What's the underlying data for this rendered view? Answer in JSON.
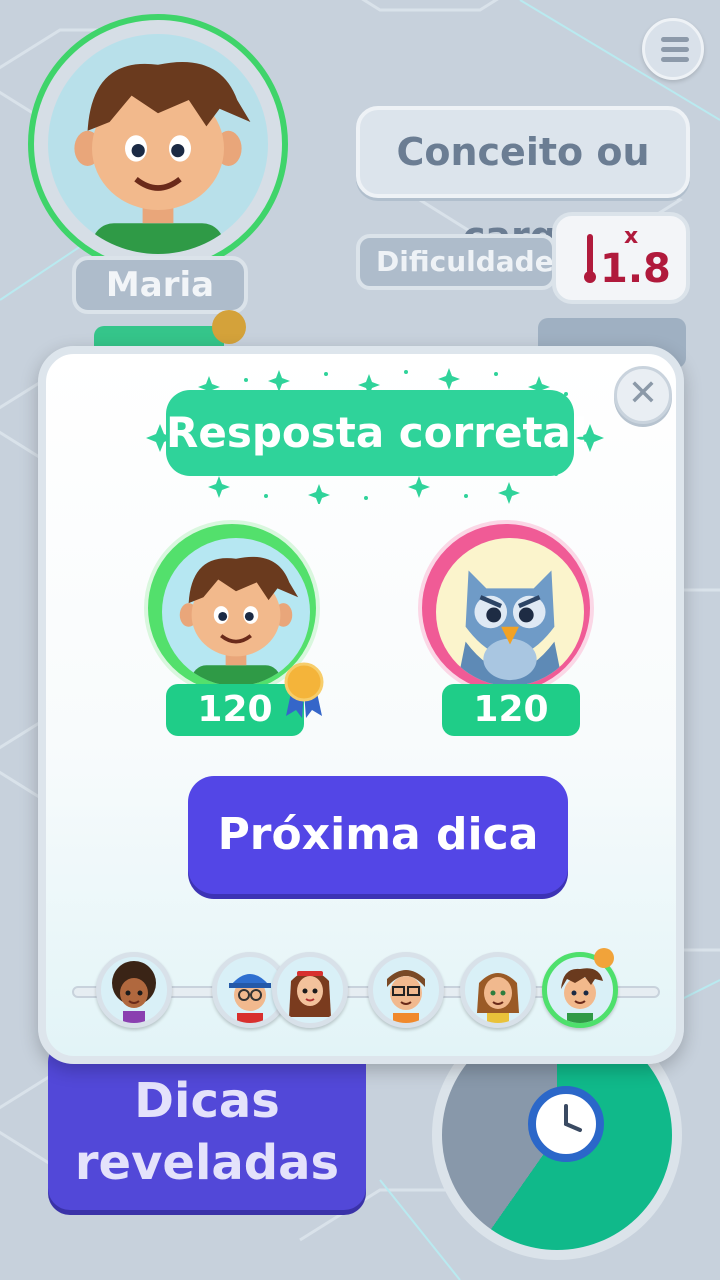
{
  "header": {
    "player_name": "Maria",
    "category": "Conceito ou cargo",
    "difficulty_label": "Dificuldade",
    "multiplier_symbol": "x",
    "multiplier_value": "1.8",
    "player_score_partial": "",
    "round_partial": ""
  },
  "modal": {
    "banner": "Resposta correta!",
    "close_symbol": "✕",
    "players": [
      {
        "role": "player",
        "score": "120",
        "ring_color": "#53e06c"
      },
      {
        "role": "owl",
        "score": "120",
        "ring_color": "#f05b96"
      }
    ],
    "next_button": "Próxima dica",
    "turn_order": [
      "afro-girl",
      "cap-boy",
      "red-haired-girl",
      "glasses-boy",
      "long-haired-guy",
      "maria"
    ]
  },
  "footer": {
    "hints_line1": "Dicas",
    "hints_line2": "reveladas"
  },
  "colors": {
    "accent_green": "#1fcd88",
    "button_purple": "#5346e6",
    "danger_red": "#b01a3c"
  }
}
